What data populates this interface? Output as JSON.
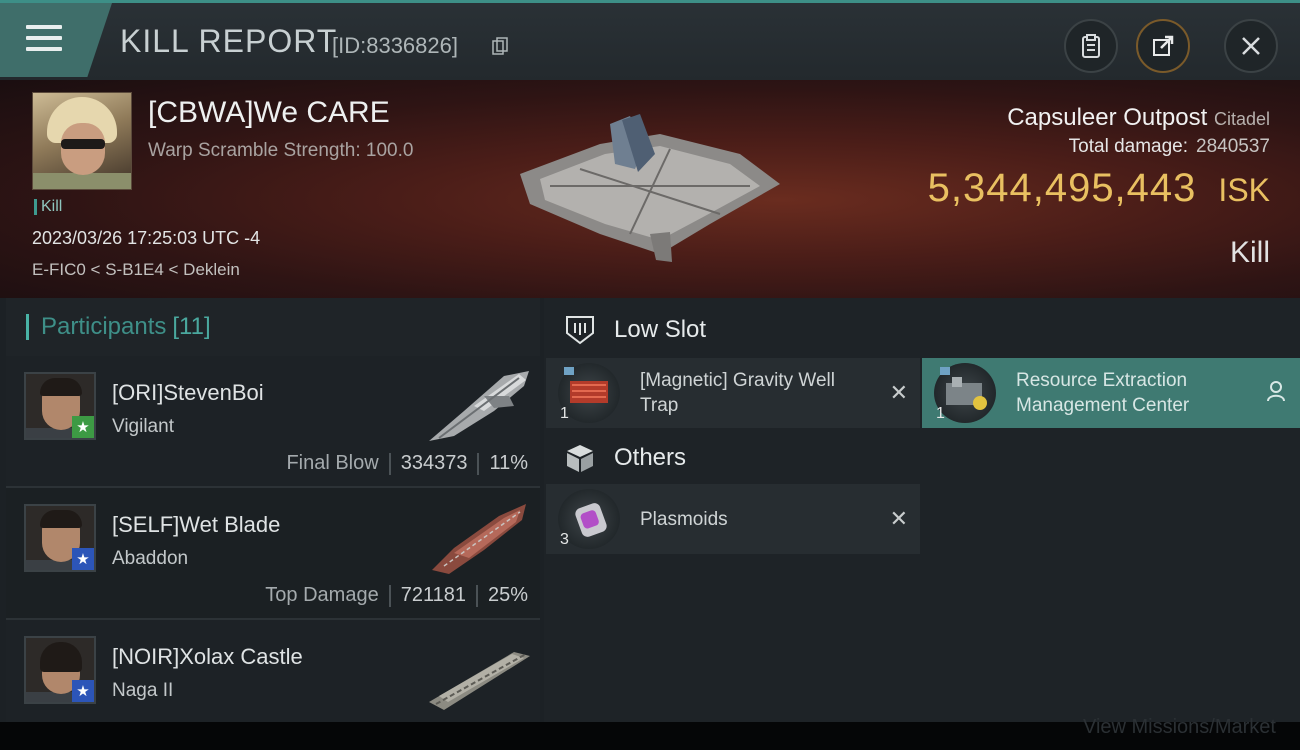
{
  "header": {
    "title": "KILL REPORT",
    "report_id": "[ID:8336826]",
    "buttons": [
      "clipboard-icon",
      "share-icon",
      "close-icon"
    ]
  },
  "victim": {
    "name": "[CBWA]We CARE",
    "scramble": "Warp Scramble Strength: 100.0",
    "tag": "Kill",
    "datetime": "2023/03/26 17:25:03 UTC -4",
    "location": "E-FIC0 < S-B1E4 < Deklein"
  },
  "loss": {
    "ship_name": "Capsuleer Outpost",
    "ship_class": "Citadel",
    "total_damage_label": "Total damage:",
    "total_damage_value": "2840537",
    "isk_value": "5,344,495,443",
    "isk_unit": "ISK",
    "result": "Kill"
  },
  "participants": {
    "label": "Participants",
    "count": "[11]",
    "rows": [
      {
        "name": "[ORI]StevenBoi",
        "ship": "Vigilant",
        "role": "Final Blow",
        "damage": "334373",
        "percent": "11%",
        "badge": "green"
      },
      {
        "name": "[SELF]Wet Blade",
        "ship": "Abaddon",
        "role": "Top Damage",
        "damage": "721181",
        "percent": "25%",
        "badge": "blue"
      },
      {
        "name": "[NOIR]Xolax Castle",
        "ship": "Naga II",
        "role": "",
        "damage": "",
        "percent": "",
        "badge": "blue"
      }
    ]
  },
  "slots": {
    "low_slot_title": "Low Slot",
    "low_items": [
      {
        "qty": "1",
        "name": "[Magnetic] Gravity Well Trap",
        "status": "destroyed"
      },
      {
        "qty": "1",
        "name": "Resource Extraction Management Center",
        "status": "dropped"
      }
    ],
    "others_title": "Others",
    "other_items": [
      {
        "qty": "3",
        "name": "Plasmoids",
        "status": "destroyed"
      }
    ]
  },
  "footer": {
    "ghost_text": "View Missions/Market"
  },
  "colors": {
    "accent": "#3e8f88",
    "isk": "#e9c061",
    "dropped": "#3f7a72"
  }
}
